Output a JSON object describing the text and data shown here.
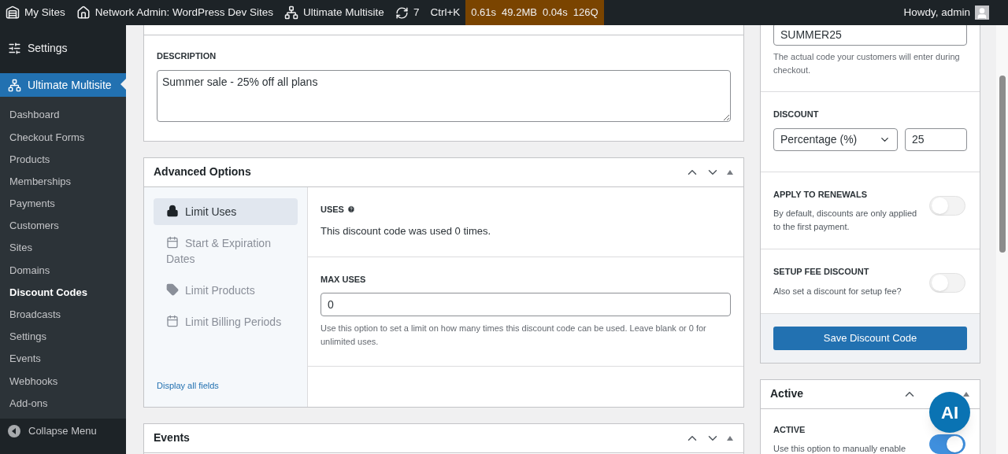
{
  "admin_bar": {
    "items": [
      {
        "kind": "sites",
        "label": "My Sites"
      },
      {
        "kind": "home",
        "label": "Network Admin: WordPress Dev Sites"
      },
      {
        "kind": "network",
        "label": "Ultimate Multisite"
      },
      {
        "kind": "updates",
        "label": "7"
      },
      {
        "kind": "text",
        "label": "Ctrl+K"
      }
    ],
    "perf": [
      "0.61s",
      "49.2MB",
      "0.04s",
      "126Q"
    ],
    "greeting": "Howdy, admin"
  },
  "sidebar": {
    "top_items": [
      {
        "kind": "settings",
        "label": "Settings",
        "selected": false
      },
      {
        "kind": "network",
        "label": "Ultimate Multisite",
        "selected": true
      }
    ],
    "submenu": [
      {
        "label": "Dashboard",
        "selected": false
      },
      {
        "label": "Checkout Forms",
        "selected": false
      },
      {
        "label": "Products",
        "selected": false
      },
      {
        "label": "Memberships",
        "selected": false
      },
      {
        "label": "Payments",
        "selected": false
      },
      {
        "label": "Customers",
        "selected": false
      },
      {
        "label": "Sites",
        "selected": false
      },
      {
        "label": "Domains",
        "selected": false
      },
      {
        "label": "Discount Codes",
        "selected": true
      },
      {
        "label": "Broadcasts",
        "selected": false
      },
      {
        "label": "Settings",
        "selected": false
      },
      {
        "label": "Events",
        "selected": false
      },
      {
        "label": "Webhooks",
        "selected": false
      },
      {
        "label": "Add-ons",
        "selected": false
      }
    ],
    "collapse": "Collapse Menu"
  },
  "description": {
    "label": "DESCRIPTION",
    "value": "Summer sale - 25% off all plans"
  },
  "advanced_options": {
    "title": "Advanced Options",
    "tabs": [
      {
        "kind": "lock",
        "label": "Limit Uses",
        "selected": true
      },
      {
        "kind": "calendar",
        "label": "Start & Expiration Dates",
        "selected": false
      },
      {
        "kind": "tag",
        "label": "Limit Products",
        "selected": false
      },
      {
        "kind": "calendar",
        "label": "Limit Billing Periods",
        "selected": false
      }
    ],
    "display_all": "Display all fields",
    "uses": {
      "label": "USES",
      "text": "This discount code was used 0 times."
    },
    "max_uses": {
      "label": "MAX USES",
      "value": "0",
      "help": "Use this option to set a limit on how many times this discount code can be used. Leave blank or 0 for unlimited uses."
    }
  },
  "events": {
    "title": "Events"
  },
  "code_card": {
    "value": "SUMMER25",
    "help": "The actual code your customers will enter during checkout.",
    "discount": {
      "label": "DISCOUNT",
      "type": "Percentage (%)",
      "amount": "25"
    },
    "toggles": [
      {
        "label": "APPLY TO RENEWALS",
        "text": "By default, discounts are only applied to the first payment.",
        "on": false
      },
      {
        "label": "SETUP FEE DISCOUNT",
        "text": "Also set a discount for setup fee?",
        "on": false
      }
    ],
    "save": "Save Discount Code"
  },
  "active_card": {
    "title": "Active",
    "label": "ACTIVE",
    "text": "Use this option to manually enable",
    "on": true
  },
  "ai_button": {
    "label": "AI"
  }
}
